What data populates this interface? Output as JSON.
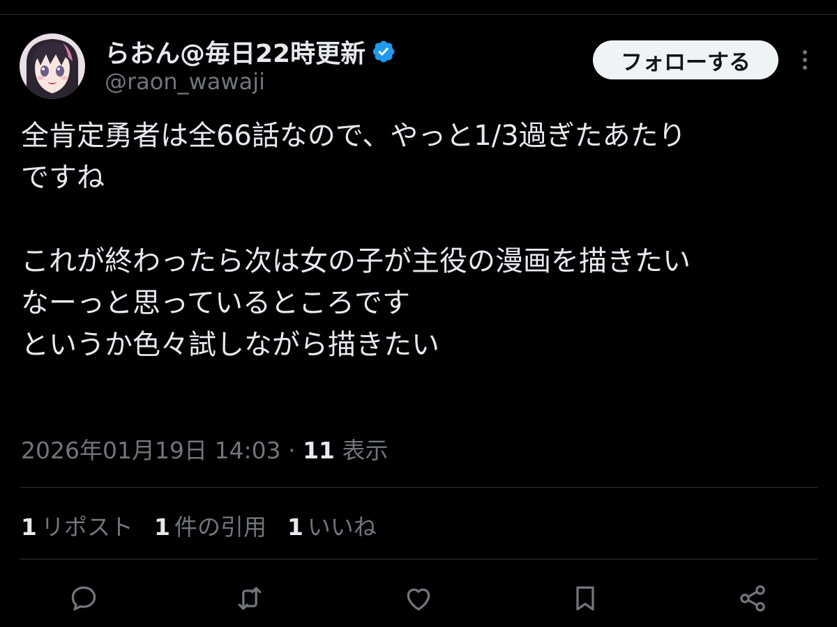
{
  "author": {
    "display_name": "らおん@毎日22時更新",
    "handle": "@raon_wawaji",
    "verified_color": "#1d9bf0"
  },
  "header": {
    "follow_label": "フォローする",
    "more_icon": "more-vertical-icon"
  },
  "tweet": {
    "lines": [
      "全肯定勇者は全66話なので、やっと1/3過ぎたあたり",
      "ですね",
      "",
      "これが終わったら次は女の子が主役の漫画を描きたい",
      "なーっと思っているところです",
      "というか色々試しながら描きたい"
    ]
  },
  "meta": {
    "timestamp": "2026年01月19日 14:03",
    "separator": "·",
    "views_count": "11",
    "views_label": "表示"
  },
  "stats": [
    {
      "count": "1",
      "label": "リポスト"
    },
    {
      "count": "1",
      "label": "件の引用"
    },
    {
      "count": "1",
      "label": "いいね"
    }
  ],
  "actions": [
    {
      "name": "reply",
      "icon": "reply-icon"
    },
    {
      "name": "repost",
      "icon": "repost-icon"
    },
    {
      "name": "like",
      "icon": "heart-icon"
    },
    {
      "name": "bookmark",
      "icon": "bookmark-icon"
    },
    {
      "name": "share",
      "icon": "share-icon"
    }
  ],
  "colors": {
    "background": "#000000",
    "text": "#e7e9ea",
    "secondary_text": "#71767b",
    "divider": "#2f3336",
    "follow_bg": "#eff3f4"
  }
}
